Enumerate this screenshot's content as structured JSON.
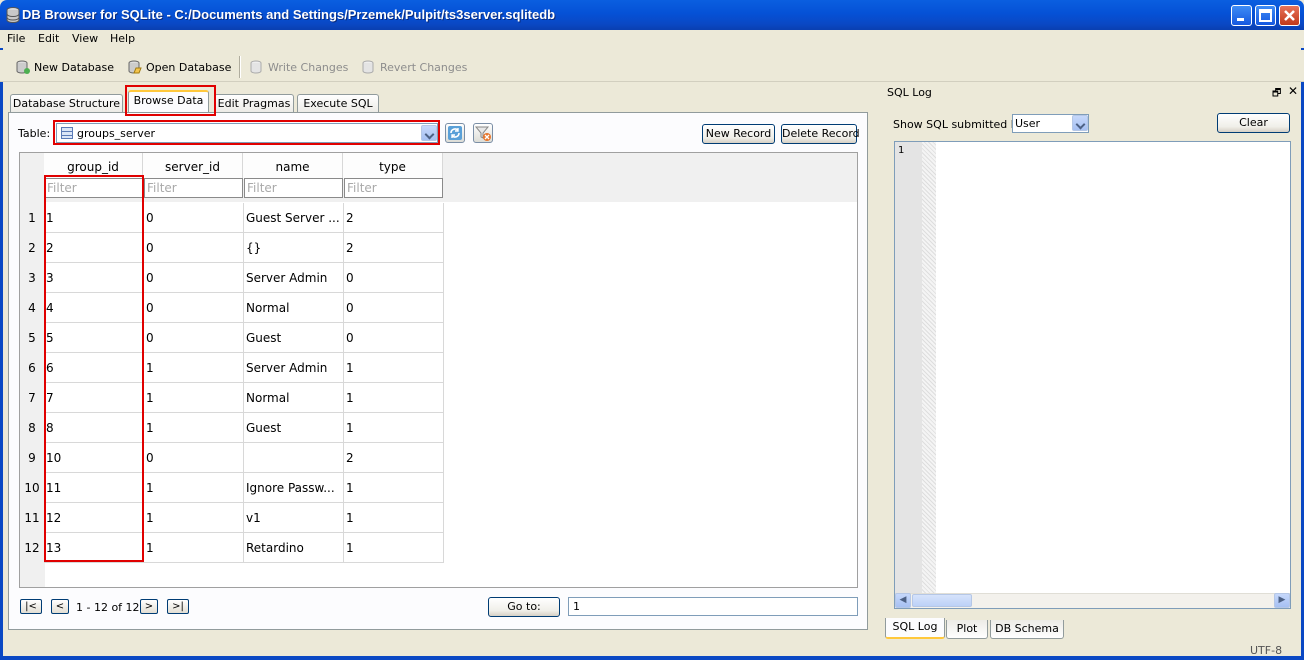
{
  "window": {
    "title": "DB Browser for SQLite - C:/Documents and Settings/Przemek/Pulpit/ts3server.sqlitedb"
  },
  "menu": [
    "File",
    "Edit",
    "View",
    "Help"
  ],
  "toolbar": {
    "new_database": "New Database",
    "open_database": "Open Database",
    "write_changes": "Write Changes",
    "revert_changes": "Revert Changes"
  },
  "tabs": [
    "Database Structure",
    "Browse Data",
    "Edit Pragmas",
    "Execute SQL"
  ],
  "active_tab": "Browse Data",
  "browse": {
    "table_label": "Table:",
    "table_value": "groups_server",
    "new_record": "New Record",
    "delete_record": "Delete Record",
    "columns": [
      "group_id",
      "server_id",
      "name",
      "type"
    ],
    "filter_placeholder": "Filter",
    "rows": [
      [
        "1",
        "0",
        "Guest Server ...",
        "2"
      ],
      [
        "2",
        "0",
        "{}",
        "2"
      ],
      [
        "3",
        "0",
        "Server Admin",
        "0"
      ],
      [
        "4",
        "0",
        "Normal",
        "0"
      ],
      [
        "5",
        "0",
        "Guest",
        "0"
      ],
      [
        "6",
        "1",
        "Server Admin",
        "1"
      ],
      [
        "7",
        "1",
        "Normal",
        "1"
      ],
      [
        "8",
        "1",
        "Guest",
        "1"
      ],
      [
        "10",
        "0",
        "",
        "2"
      ],
      [
        "11",
        "1",
        "Ignore Passw...",
        "1"
      ],
      [
        "12",
        "1",
        "v1",
        "1"
      ],
      [
        "13",
        "1",
        "Retardino",
        "1"
      ]
    ],
    "nav": {
      "first": "|<",
      "prev": "<",
      "next": ">",
      "last": ">|",
      "record_count": "1 - 12 of 12",
      "goto_label": "Go to:",
      "goto_value": "1"
    }
  },
  "sql_log": {
    "title": "SQL Log",
    "show_label": "Show SQL submitted by",
    "submitted_by": "User",
    "clear": "Clear",
    "line_number": "1"
  },
  "bottom_tabs": [
    "SQL Log",
    "Plot",
    "DB Schema"
  ],
  "active_bottom_tab": "SQL Log",
  "status": {
    "encoding": "UTF-8"
  },
  "colors": {
    "title_bar": "#0551d6",
    "highlight": "#e00000",
    "tab_accent": "#ffc83c"
  }
}
